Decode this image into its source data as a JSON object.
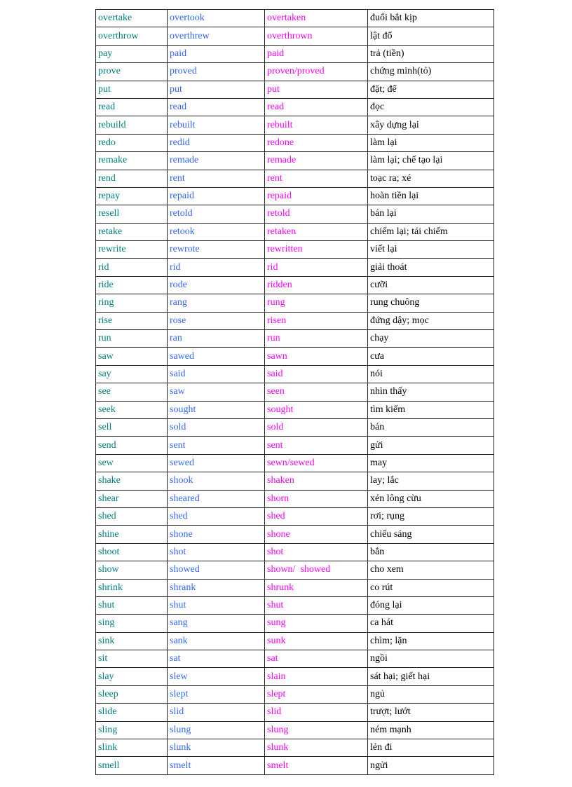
{
  "colors": {
    "base": "#008080",
    "past": "#3366ff",
    "participle": "#ff00ff",
    "meaning": "#000000"
  },
  "rows": [
    [
      "overtake",
      "overtook",
      "overtaken",
      "đuổi bắt kịp"
    ],
    [
      "overthrow",
      "overthrew",
      "overthrown",
      "lật đổ"
    ],
    [
      "pay",
      "paid",
      "paid",
      "trả (tiền)"
    ],
    [
      "prove",
      "proved",
      "proven/proved",
      "chứng minh(tỏ)"
    ],
    [
      "put",
      "put",
      "put",
      "đặt; để"
    ],
    [
      "read",
      "read",
      "read",
      "đọc"
    ],
    [
      "rebuild",
      "rebuilt",
      "rebuilt",
      "xây dựng lại"
    ],
    [
      "redo",
      "redid",
      "redone",
      "làm lại"
    ],
    [
      "remake",
      "remade",
      "remade",
      "làm lại; chế tạo lại"
    ],
    [
      "rend",
      "rent",
      "rent",
      "toạc ra; xé"
    ],
    [
      "repay",
      "repaid",
      "repaid",
      "hoàn tiền lại"
    ],
    [
      "resell",
      "retold",
      "retold",
      "bán lại"
    ],
    [
      "retake",
      "retook",
      "retaken",
      "chiếm lại; tái chiếm"
    ],
    [
      "rewrite",
      "rewrote",
      "rewritten",
      "viết lại"
    ],
    [
      "rid",
      "rid",
      "rid",
      "giải thoát"
    ],
    [
      "ride",
      "rode",
      "ridden",
      "cưỡi"
    ],
    [
      "ring",
      "rang",
      "rung",
      "rung chuông"
    ],
    [
      "rise",
      "rose",
      "risen",
      "đứng dậy; mọc"
    ],
    [
      "run",
      "ran",
      "run",
      "chạy"
    ],
    [
      "saw",
      "sawed",
      "sawn",
      "cưa"
    ],
    [
      "say",
      "said",
      "said",
      "nói"
    ],
    [
      "see",
      "saw",
      "seen",
      "nhìn thấy"
    ],
    [
      "seek",
      "sought",
      "sought",
      "tìm kiếm"
    ],
    [
      "sell",
      "sold",
      "sold",
      "bán"
    ],
    [
      "send",
      "sent",
      "sent",
      "gửi"
    ],
    [
      "sew",
      "sewed",
      "sewn/sewed",
      "may"
    ],
    [
      "shake",
      "shook",
      "shaken",
      "lay; lắc"
    ],
    [
      "shear",
      "sheared",
      "shorn",
      "xén lông cừu"
    ],
    [
      "shed",
      "shed",
      "shed",
      "rơi; rụng"
    ],
    [
      "shine",
      "shone",
      "shone",
      "chiếu sáng"
    ],
    [
      "shoot",
      "shot",
      "shot",
      "bắn"
    ],
    [
      "show",
      "showed",
      "shown/  showed",
      "cho xem"
    ],
    [
      "shrink",
      "shrank",
      "shrunk",
      "co rút"
    ],
    [
      "shut",
      "shut",
      "shut",
      "đóng lại"
    ],
    [
      "sing",
      "sang",
      "sung",
      "ca hát"
    ],
    [
      "sink",
      "sank",
      "sunk",
      "chìm; lặn"
    ],
    [
      "sit",
      "sat",
      "sat",
      "ngồi"
    ],
    [
      "slay",
      "slew",
      "slain",
      "sát hại; giết hại"
    ],
    [
      "sleep",
      "slept",
      "slept",
      "ngủ"
    ],
    [
      "slide",
      "slid",
      "slid",
      "trượt; lướt"
    ],
    [
      "sling",
      "slung",
      "slung",
      "ném mạnh"
    ],
    [
      "slink",
      "slunk",
      "slunk",
      "lẻn đi"
    ],
    [
      "smell",
      "smelt",
      "smelt",
      "ngửi"
    ]
  ]
}
